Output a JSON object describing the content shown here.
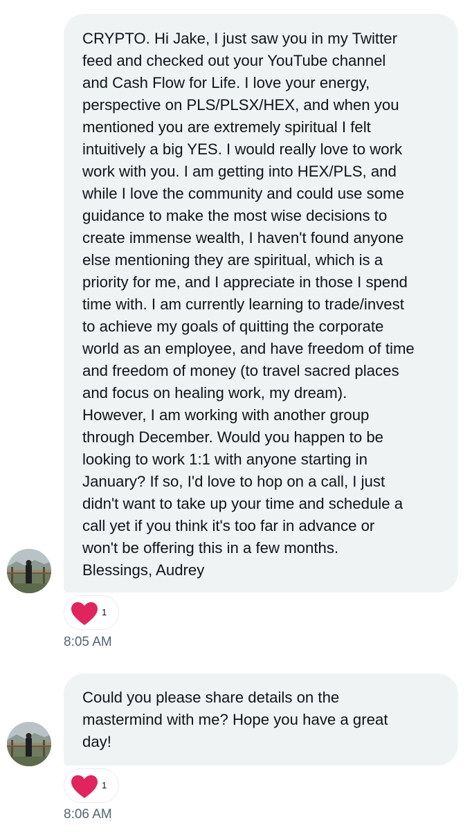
{
  "messages": [
    {
      "text": "CRYPTO. Hi Jake, I just saw you in my Twitter\nfeed and checked out your YouTube channel\nand Cash Flow for Life. I love your energy,\nperspective on PLS/PLSX/HEX, and when you\nmentioned you are extremely spiritual I felt\nintuitively a big YES. I would really love to work\nwork with you. I am getting into HEX/PLS, and\nwhile I love the community and could use some\nguidance to make the most wise decisions to\ncreate immense wealth, I haven't found anyone\nelse mentioning they are spiritual, which is a\npriority for me, and I appreciate in those I spend\ntime with. I am currently learning to trade/invest\nto achieve my goals of quitting the corporate\nworld as an employee, and have freedom of time\nand freedom of money (to travel sacred places\nand focus on healing work, my dream).\nHowever, I am working with another group\nthrough December. Would you happen to be\nlooking to work 1:1 with anyone starting in\nJanuary? If so, I'd love to hop on a call, I just\ndidn't want to take up your time and schedule a\ncall yet if you think it's too far in advance or\nwon't be offering this in a few months.\nBlessings, Audrey",
      "reaction": {
        "icon": "heart-icon",
        "count": "1",
        "color": "#e0245e"
      },
      "time": "8:05 AM"
    },
    {
      "text": "Could you please share details on the\nmastermind with me? Hope you have a great\nday!",
      "reaction": {
        "icon": "heart-icon",
        "count": "1",
        "color": "#e0245e"
      },
      "time": "8:06 AM"
    }
  ],
  "colors": {
    "bubble_bg": "#eff3f4",
    "text": "#0f1419",
    "timestamp": "#536471",
    "heart": "#e0245e"
  }
}
